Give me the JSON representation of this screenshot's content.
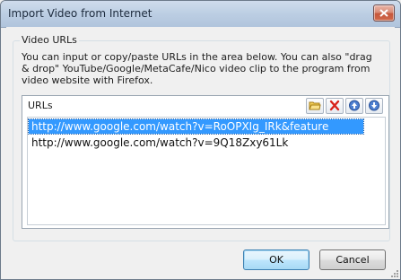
{
  "window": {
    "title": "Import Video from Internet",
    "close_icon": "close-icon"
  },
  "group": {
    "legend": "Video URLs",
    "description": "You can input or copy/paste URLs in the area below. You can also \"drag & drop\" YouTube/Google/MetaCafe/Nico video clip to the program from video website with Firefox."
  },
  "urls": {
    "label": "URLs",
    "toolbar": [
      {
        "name": "open-folder-icon"
      },
      {
        "name": "delete-icon"
      },
      {
        "name": "move-up-icon"
      },
      {
        "name": "move-down-icon"
      }
    ],
    "items": [
      {
        "text": "http://www.google.com/watch?v=RoOPXIg_IRk&feature",
        "selected": true
      },
      {
        "text": "http://www.google.com/watch?v=9Q18Zxy61Lk",
        "selected": false
      }
    ]
  },
  "buttons": {
    "ok": "OK",
    "cancel": "Cancel"
  },
  "colors": {
    "selection": "#3399ff",
    "titlebar": "#bccee3",
    "close": "#c5573b"
  }
}
